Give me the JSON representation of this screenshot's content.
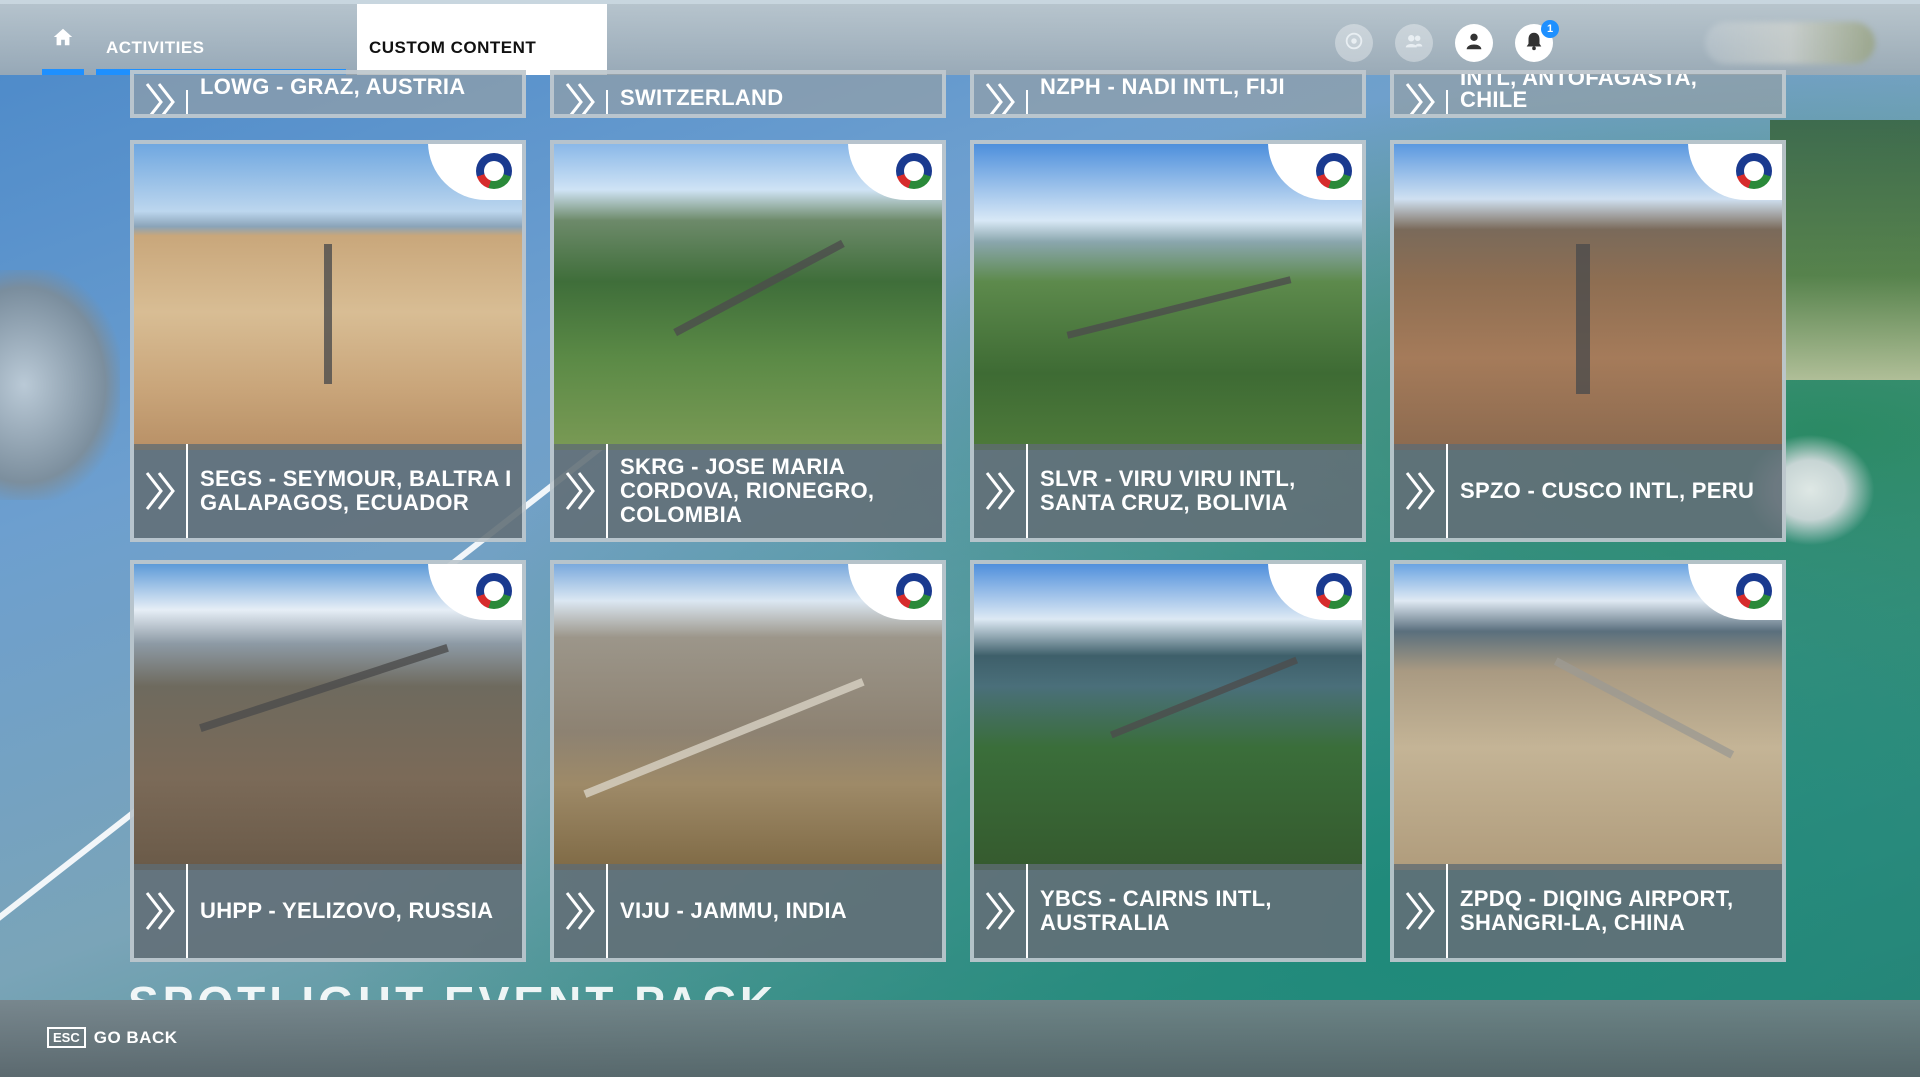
{
  "nav": {
    "home_icon": "home-icon",
    "activities_label": "ACTIVITIES",
    "custom_content_label": "CUSTOM CONTENT"
  },
  "top_icons": {
    "notification_count": "1",
    "icons": [
      "rewards-icon",
      "friends-icon",
      "profile-icon",
      "notifications-icon"
    ]
  },
  "colors": {
    "accent": "#1e90ff"
  },
  "top_row": [
    "LOWG - GRAZ, AUSTRIA",
    "SWITZERLAND",
    "NZPH - NADI INTL, FIJI",
    "INTL, ANTOFAGASTA,\nCHILE"
  ],
  "cards": [
    {
      "label": "SEGS - SEYMOUR, BALTRA I\nGALAPAGOS, ECUADOR"
    },
    {
      "label": "SKRG - JOSE MARIA\nCORDOVA, RIONEGRO,\nCOLOMBIA"
    },
    {
      "label": "SLVR - VIRU VIRU INTL,\nSANTA CRUZ, BOLIVIA"
    },
    {
      "label": "SPZO - CUSCO INTL, PERU"
    },
    {
      "label": "UHPP - YELIZOVO, RUSSIA"
    },
    {
      "label": "VIJU - JAMMU, INDIA"
    },
    {
      "label": "YBCS - CAIRNS INTL,\nAUSTRALIA"
    },
    {
      "label": "ZPDQ - DIQING AIRPORT,\nSHANGRI-LA, CHINA"
    }
  ],
  "section_heading": "SPOTLIGHT EVENT PACK",
  "footer": {
    "esc_key": "ESC",
    "back_label": "GO BACK"
  }
}
